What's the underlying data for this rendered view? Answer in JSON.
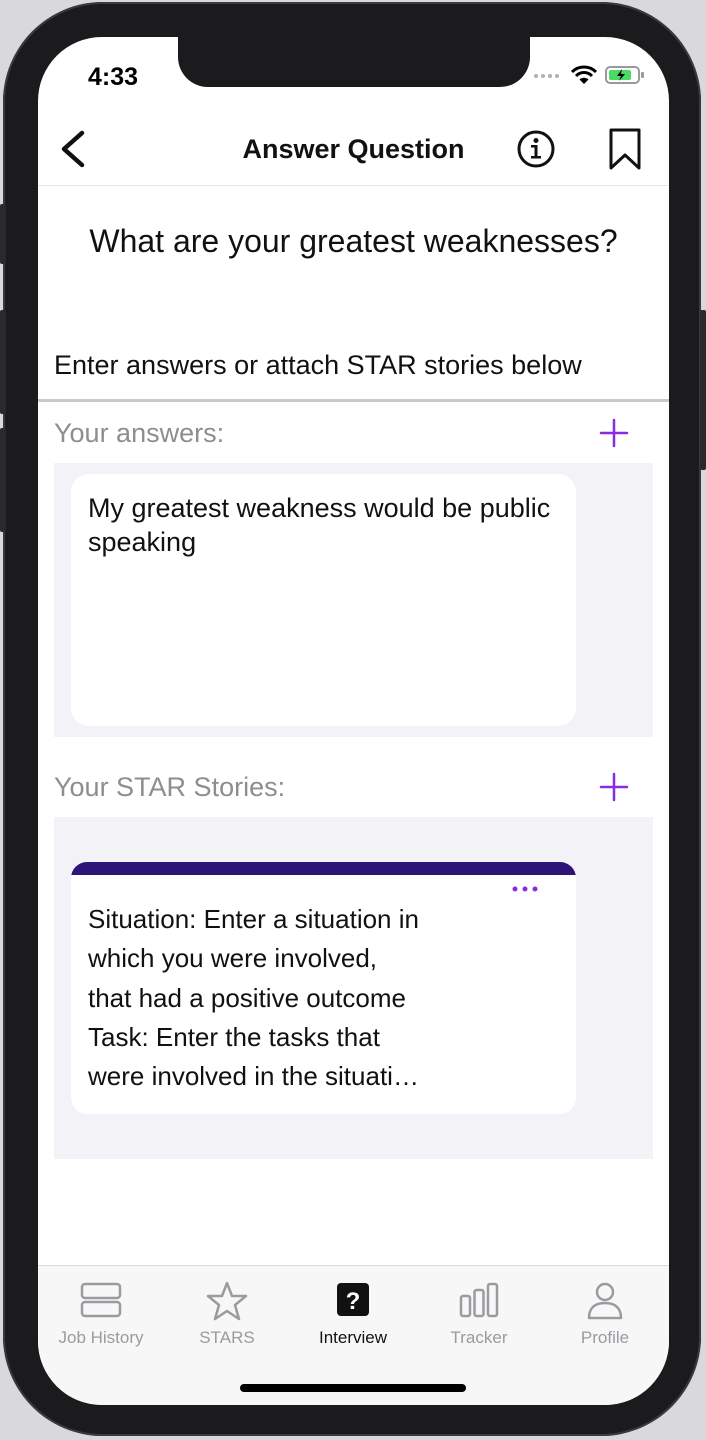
{
  "status": {
    "time": "4:33"
  },
  "nav": {
    "title": "Answer Question"
  },
  "question": "What are your greatest weaknesses?",
  "instruction": "Enter answers or attach STAR stories below",
  "answers": {
    "label": "Your answers:",
    "items": [
      "My greatest weakness would be public speaking"
    ]
  },
  "stories": {
    "label": "Your STAR Stories:",
    "items": [
      {
        "text": "Situation: Enter a situation in\nwhich you were involved,\nthat had a positive outcome\nTask: Enter the tasks that\nwere involved in the situati…"
      }
    ]
  },
  "tabs": [
    {
      "label": "Job History",
      "icon": "job-history-icon",
      "active": false
    },
    {
      "label": "STARS",
      "icon": "star-icon",
      "active": false
    },
    {
      "label": "Interview",
      "icon": "question-icon",
      "active": true
    },
    {
      "label": "Tracker",
      "icon": "bar-chart-icon",
      "active": false
    },
    {
      "label": "Profile",
      "icon": "person-icon",
      "active": false
    }
  ],
  "colors": {
    "accent": "#8a2be2",
    "star_bar": "#2e1478",
    "panel": "#f2f2f7"
  }
}
